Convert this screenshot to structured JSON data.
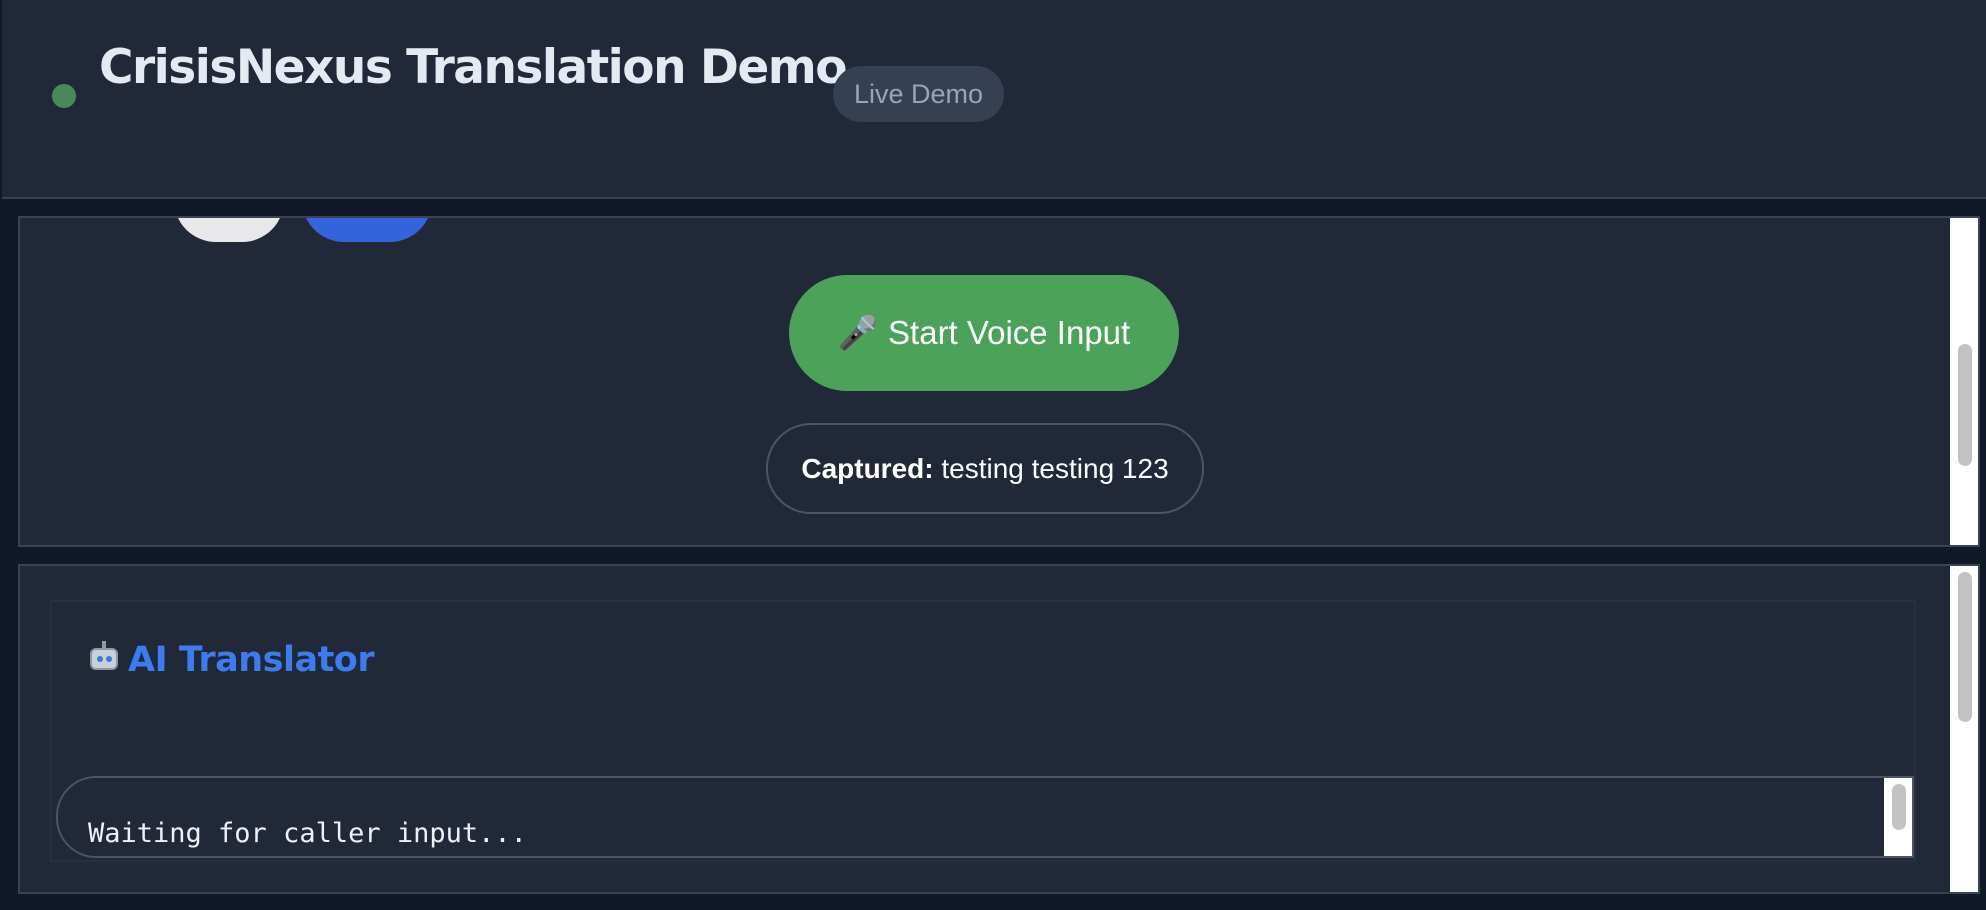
{
  "header": {
    "title": "CrisisNexus Translation Demo",
    "badge": "Live Demo"
  },
  "voice": {
    "button_label": "🎤 Start Voice Input",
    "captured_label": "Captured:",
    "captured_text": " testing testing 123"
  },
  "translator": {
    "heading": "AI Translator",
    "output_text": "Waiting for caller input..."
  },
  "icons": {
    "status": "status-dot",
    "translator": "robot-icon",
    "voice": "microphone-icon"
  },
  "colors": {
    "accent_green": "#4ba35a",
    "accent_blue": "#3b7cf0",
    "status_dot": "#4a8a5a",
    "panel_bg": "#212838",
    "page_bg": "#111827"
  }
}
